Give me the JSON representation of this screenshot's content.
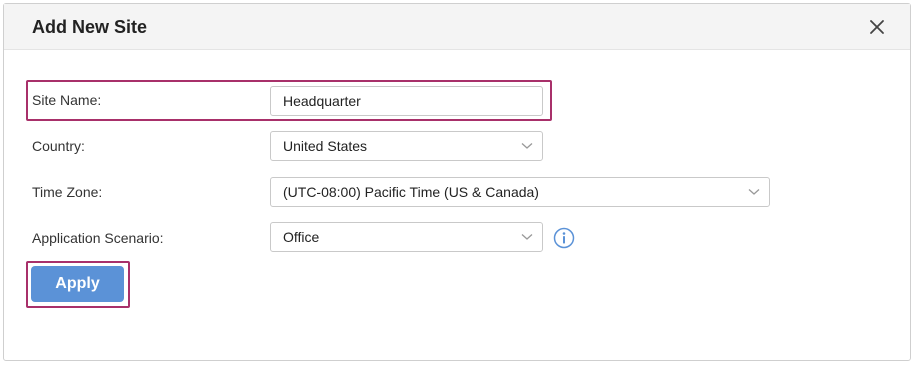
{
  "dialog": {
    "title": "Add New Site",
    "close_icon": "close-icon"
  },
  "form": {
    "site_name": {
      "label": "Site Name:",
      "value": "Headquarter"
    },
    "country": {
      "label": "Country:",
      "value": "United States"
    },
    "time_zone": {
      "label": "Time Zone:",
      "value": "(UTC-08:00) Pacific Time (US & Canada)"
    },
    "application_scenario": {
      "label": "Application Scenario:",
      "value": "Office",
      "info_icon": "info-icon"
    }
  },
  "actions": {
    "apply_label": "Apply"
  },
  "colors": {
    "highlight": "#a8306a",
    "primary_button": "#5b92d7",
    "info_icon": "#5b92d7",
    "header_bg": "#f4f4f4"
  }
}
